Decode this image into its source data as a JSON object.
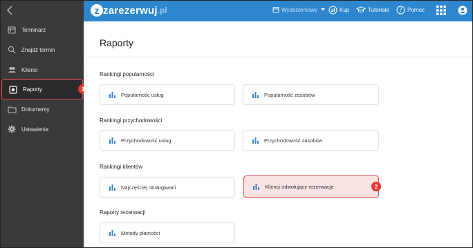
{
  "app": {
    "logo_text": "zarezerwuj",
    "logo_letter": "z",
    "logo_suffix": ".pl"
  },
  "topbar": {
    "calendar_view_label": "Wydarzeniowy",
    "buy_label": "Kup",
    "tutorials_label": "Tutoriale",
    "help_label": "Pomoc"
  },
  "sidebar": {
    "items": [
      {
        "label": "Terminarz",
        "icon": "calendar-icon"
      },
      {
        "label": "Znajdź termin",
        "icon": "search-icon"
      },
      {
        "label": "Klienci",
        "icon": "users-icon"
      },
      {
        "label": "Raporty",
        "icon": "report-icon"
      },
      {
        "label": "Dokumenty",
        "icon": "folder-icon"
      },
      {
        "label": "Ustawienia",
        "icon": "gear-icon"
      }
    ],
    "active_index": 3
  },
  "annotations": {
    "step1": "1",
    "step2": "2"
  },
  "main": {
    "title": "Raporty",
    "sections": [
      {
        "title": "Rankingi popularności",
        "cards": [
          "Popularność usług",
          "Popularność zasobów"
        ]
      },
      {
        "title": "Rankingi przychodowości",
        "cards": [
          "Przychodowość usług",
          "Przychodowość zasobów"
        ]
      },
      {
        "title": "Rankingi klientów",
        "cards": [
          "Najczęściej obsługiwani",
          "Klienci odwołujący rezerwacje"
        ]
      },
      {
        "title": "Raporty rezerwacji",
        "cards": [
          "Metody płatności"
        ]
      }
    ]
  },
  "colors": {
    "accent": "#2d86ce",
    "sidebar_bg": "#3a3a3c",
    "highlight_red": "#e84a4a"
  }
}
